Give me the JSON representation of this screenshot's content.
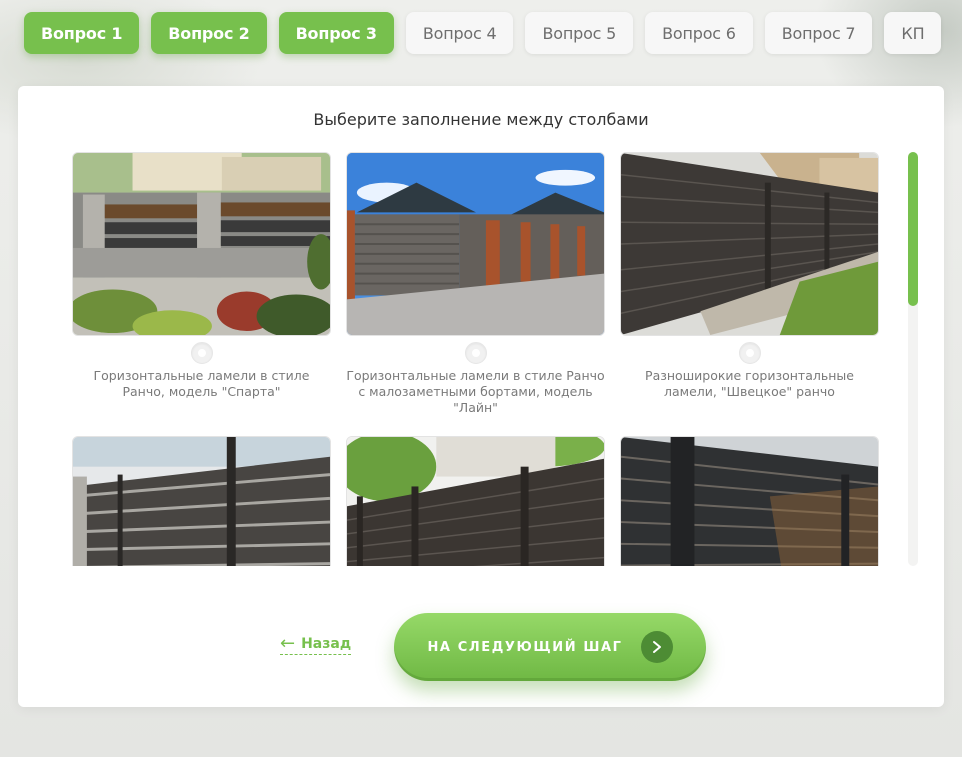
{
  "tabs": [
    {
      "label": "Вопрос 1",
      "state": "done"
    },
    {
      "label": "Вопрос 2",
      "state": "done"
    },
    {
      "label": "Вопрос 3",
      "state": "done"
    },
    {
      "label": "Вопрос 4",
      "state": "todo"
    },
    {
      "label": "Вопрос 5",
      "state": "todo"
    },
    {
      "label": "Вопрос 6",
      "state": "todo"
    },
    {
      "label": "Вопрос 7",
      "state": "todo"
    },
    {
      "label": "КП",
      "state": "todo"
    }
  ],
  "question": {
    "title": "Выберите заполнение между столбами"
  },
  "options": [
    {
      "label": "Горизонтальные ламели в стиле Ранчо, модель \"Спарта\"",
      "selected": false
    },
    {
      "label": "Горизонтальные ламели в стиле Ранчо с малозаметными бортами, модель \"Лайн\"",
      "selected": false
    },
    {
      "label": "Разноширокие горизонтальные ламели, \"Швецкое\" ранчо",
      "selected": false
    },
    {
      "label": "",
      "selected": false
    },
    {
      "label": "",
      "selected": false
    },
    {
      "label": "",
      "selected": false
    }
  ],
  "nav": {
    "back_label": "Назад",
    "back_icon": "arrow-left-icon",
    "next_label": "НА СЛЕДУЮЩИЙ ШАГ",
    "next_icon": "chevron-right-icon"
  },
  "colors": {
    "accent": "#77c04d",
    "accent_dark": "#4d8c34"
  }
}
